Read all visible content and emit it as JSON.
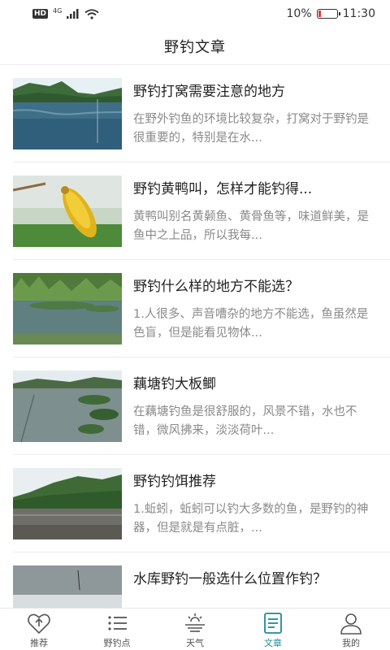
{
  "status_bar": {
    "hd": "HD",
    "network": "4G",
    "battery": "10%",
    "time": "11:30",
    "battery_color": "#e53935"
  },
  "header": {
    "title": "野钓文章"
  },
  "articles": [
    {
      "title": "野钓打窝需要注意的地方",
      "desc": "在野外钓鱼的环境比较复杂，打窝对于野钓是很重要的，特别是在水..."
    },
    {
      "title": "野钓黄鸭叫，怎样才能钓得...",
      "desc": "黄鸭叫别名黄颡鱼、黄骨鱼等，味道鲜美，是鱼中之上品，所以我每..."
    },
    {
      "title": "野钓什么样的地方不能选？",
      "desc": "1.人很多、声音嘈杂的地方不能选，鱼虽然是色盲，但是能看见物体..."
    },
    {
      "title": "藕塘钓大板鲫",
      "desc": "在藕塘钓鱼是很舒服的，风景不错，水也不错，微风拂来，淡淡荷叶..."
    },
    {
      "title": "野钓钓饵推荐",
      "desc": "1.蚯蚓，蚯蚓可以钓大多数的鱼，是野钓的神器，但是就是有点脏，..."
    },
    {
      "title": "水库野钓一般选什么位置作钓？",
      "desc": ""
    }
  ],
  "tabs": [
    {
      "label": "推荐",
      "icon": "recommend-icon",
      "active": false
    },
    {
      "label": "野钓点",
      "icon": "list-icon",
      "active": false
    },
    {
      "label": "天气",
      "icon": "weather-icon",
      "active": false
    },
    {
      "label": "文章",
      "icon": "article-icon",
      "active": true
    },
    {
      "label": "我的",
      "icon": "user-icon",
      "active": false
    }
  ],
  "colors": {
    "accent": "#1a8a9c",
    "text": "#222222",
    "subtext": "#8a8a8a"
  }
}
